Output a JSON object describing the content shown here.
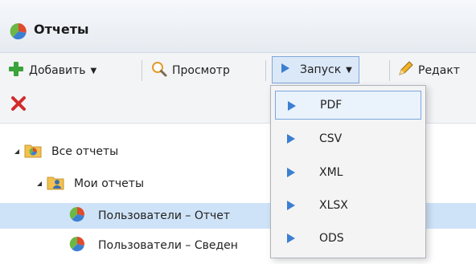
{
  "window": {
    "title": "Отчеты",
    "icon": "pie-chart-icon"
  },
  "toolbar": {
    "add_label": "Добавить",
    "view_label": "Просмотр",
    "launch_label": "Запуск",
    "edit_label": "Редакт",
    "delete_icon": "delete-icon"
  },
  "tree": {
    "root": {
      "label": "Все отчеты",
      "icon": "folder-reports-icon"
    },
    "mine": {
      "label": "Мои отчеты",
      "icon": "user-folder-icon"
    },
    "reports": [
      {
        "label": "Пользователи – Отчет",
        "selected": true
      },
      {
        "label": "Пользователи – Сведен",
        "selected": false
      }
    ]
  },
  "launch_menu": {
    "items": [
      {
        "label": "PDF",
        "active": true
      },
      {
        "label": "CSV",
        "active": false
      },
      {
        "label": "XML",
        "active": false
      },
      {
        "label": "XLSX",
        "active": false
      },
      {
        "label": "ODS",
        "active": false
      }
    ]
  },
  "colors": {
    "accent": "#3b7fd1",
    "selection": "#cfe3f8",
    "menu_active_border": "#7aa6dd",
    "delete": "#d22b2b",
    "add": "#3aa33a"
  }
}
